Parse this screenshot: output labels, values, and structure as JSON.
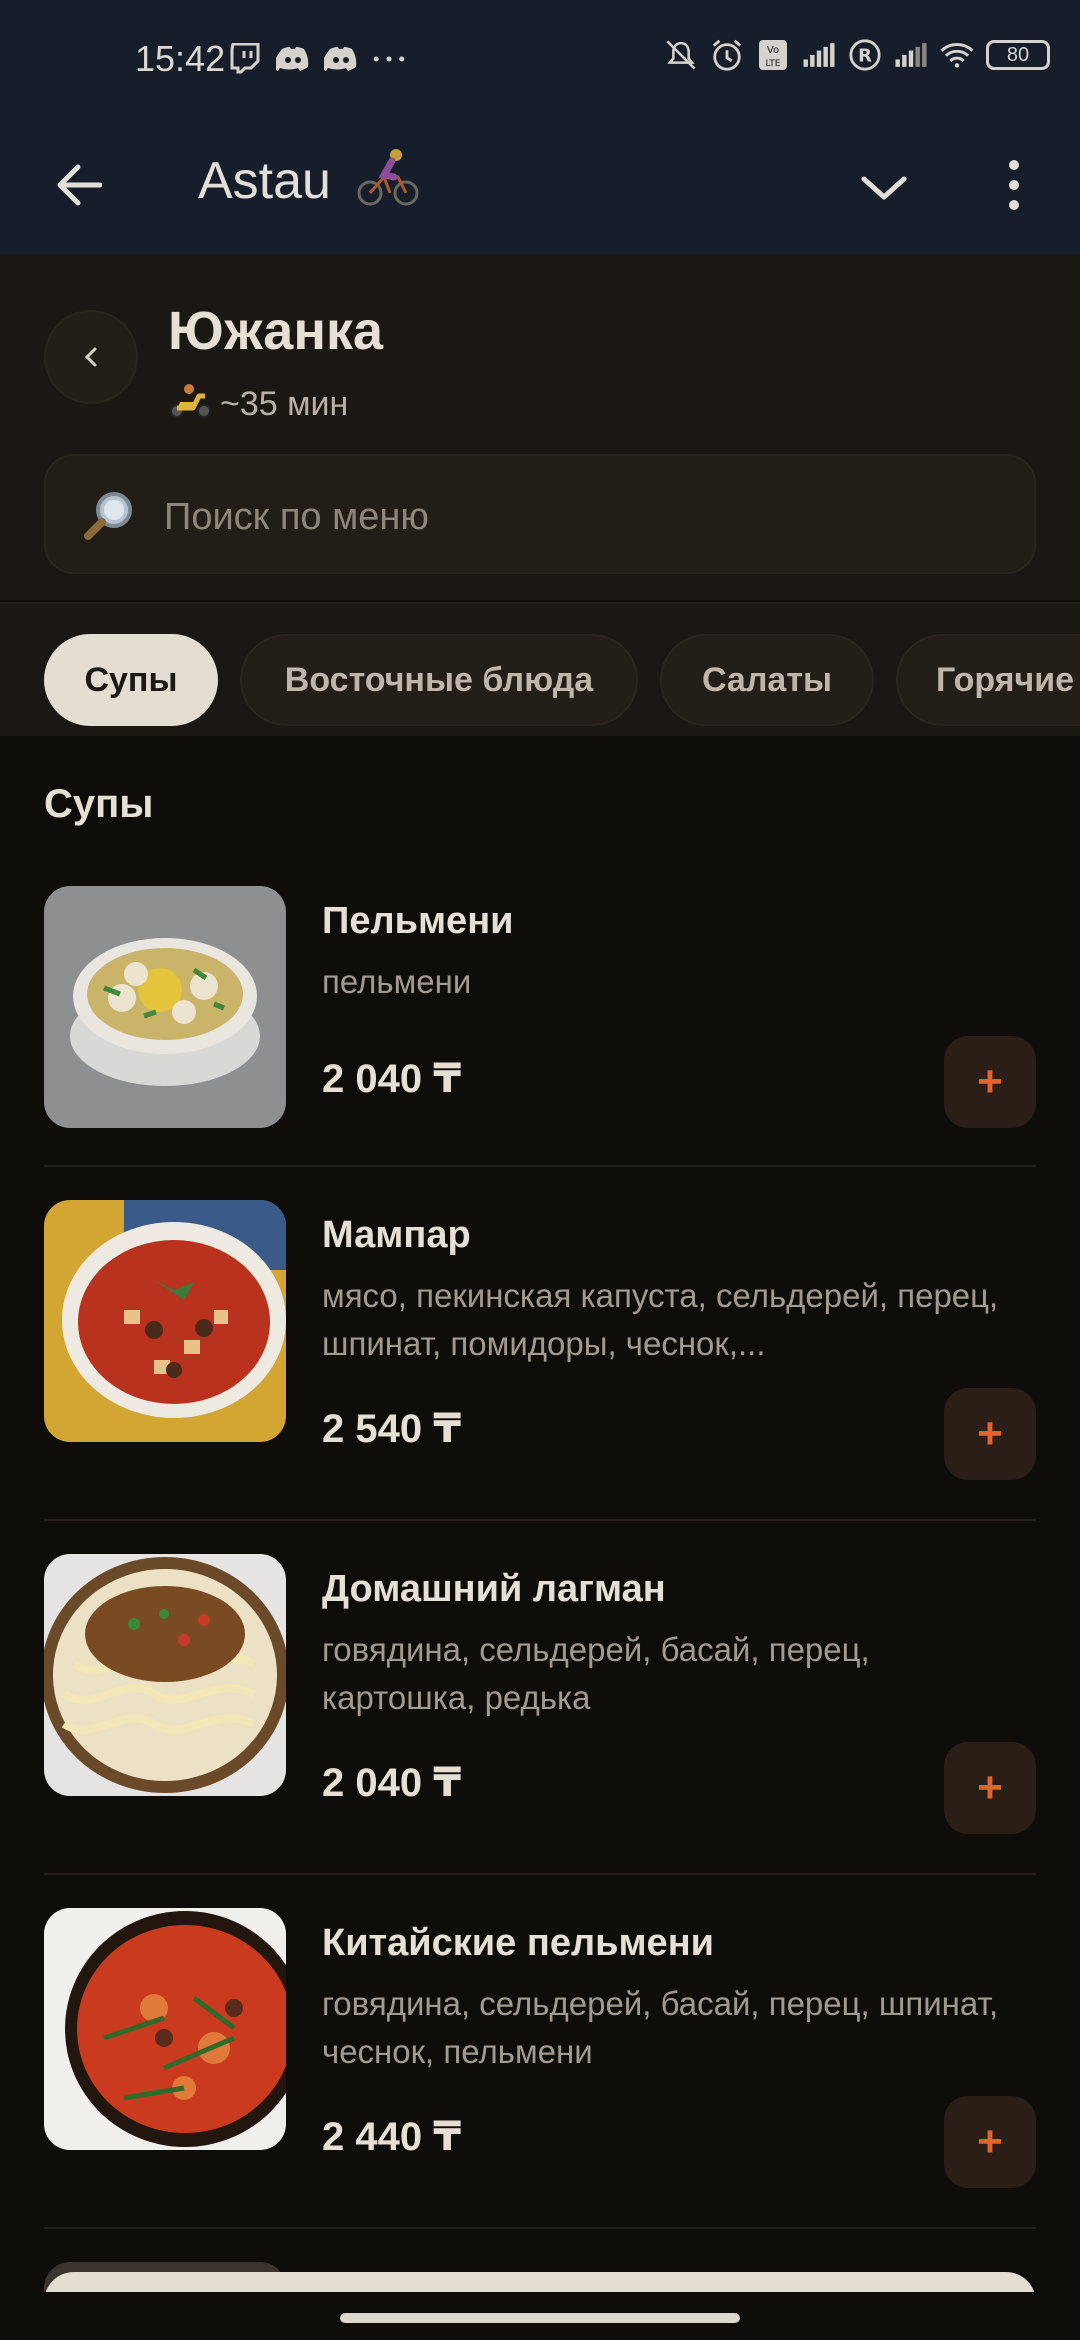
{
  "status_bar": {
    "time": "15:42",
    "battery": "80",
    "icons": [
      "twitch-icon",
      "discord-icon",
      "discord-icon",
      "more-dots-icon",
      "mute-icon",
      "alarm-icon",
      "volte-icon",
      "signal-icon",
      "roaming-icon",
      "signal-icon",
      "wifi-icon",
      "battery-icon"
    ]
  },
  "app_bar": {
    "title": "Astau",
    "title_emoji": "woman-biking-icon",
    "left_action": "back-arrow-icon",
    "right_actions": [
      "chevron-down-icon",
      "more-vert-icon"
    ]
  },
  "restaurant": {
    "name": "Южанка",
    "eta": "~35 мин",
    "eta_icon": "scooter-icon"
  },
  "search": {
    "placeholder": "Поиск по меню",
    "value": ""
  },
  "categories": [
    {
      "label": "Супы",
      "active": true
    },
    {
      "label": "Восточные блюда",
      "active": false
    },
    {
      "label": "Салаты",
      "active": false
    },
    {
      "label": "Горячие",
      "active": false
    }
  ],
  "section_title": "Супы",
  "items": [
    {
      "name": "Пельмени",
      "description": "пельмени",
      "price": "2 040 ₸"
    },
    {
      "name": "Мампар",
      "description": "мясо, пекинская капуста, сельдерей, перец, шпинат, помидоры, чеснок,...",
      "price": "2 540 ₸"
    },
    {
      "name": "Домашний лагман",
      "description": "говядина, сельдерей, басай, перец, картошка, редька",
      "price": "2 040 ₸"
    },
    {
      "name": "Китайские пельмени",
      "description": "говядина, сельдерей, басай, перец, шпинат, чеснок, пельмени",
      "price": "2 440 ₸"
    }
  ],
  "add_button_label": "+",
  "colors": {
    "top_bar": "#161d2b",
    "background": "#0f0d0a",
    "header_bg": "#1b1712",
    "accent": "#e0642b",
    "active_chip": "#e4ddd1"
  }
}
